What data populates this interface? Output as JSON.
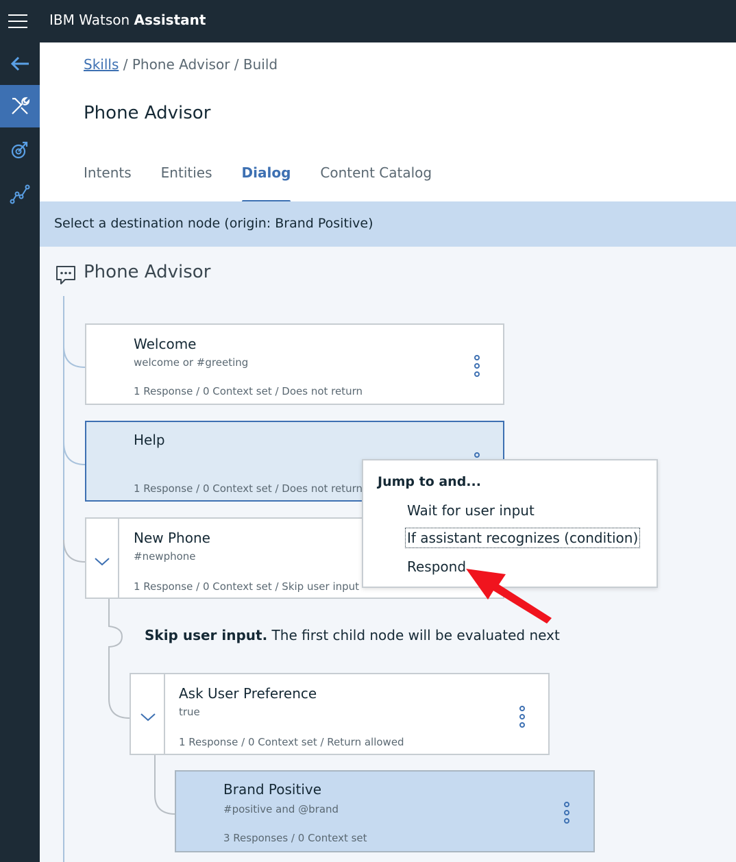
{
  "app": {
    "title_prefix": "IBM Watson",
    "title_bold": "Assistant"
  },
  "rail": {
    "items": [
      {
        "icon": "back-arrow-icon",
        "active": false
      },
      {
        "icon": "tools-icon",
        "active": true
      },
      {
        "icon": "improve-icon",
        "active": false
      },
      {
        "icon": "analytics-icon",
        "active": false
      }
    ]
  },
  "breadcrumb": {
    "link": "Skills",
    "rest": "/ Phone Advisor / Build"
  },
  "page_title": "Phone Advisor",
  "tabs": [
    {
      "label": "Intents",
      "active": false
    },
    {
      "label": "Entities",
      "active": false
    },
    {
      "label": "Dialog",
      "active": true
    },
    {
      "label": "Content Catalog",
      "active": false
    }
  ],
  "banner": {
    "text": "Select a destination node (origin: Brand Positive)"
  },
  "dialog": {
    "title": "Phone Advisor",
    "nodes": [
      {
        "title": "Welcome",
        "condition": "welcome or #greeting",
        "meta": "1 Response / 0 Context set / Does not return"
      },
      {
        "title": "Help",
        "condition": "",
        "meta": "1 Response / 0 Context set / Does not return"
      },
      {
        "title": "New Phone",
        "condition": "#newphone",
        "meta": "1 Response / 0 Context set / Skip user input"
      },
      {
        "title": "Ask User Preference",
        "condition": "true",
        "meta": "1 Response / 0 Context set / Return allowed"
      },
      {
        "title": "Brand Positive",
        "condition": "#positive and @brand",
        "meta": "3 Responses / 0 Context set"
      }
    ],
    "skip_bold": "Skip user input.",
    "skip_rest": " The first child node will be evaluated next"
  },
  "popup": {
    "title": "Jump to and...",
    "items": [
      "Wait for user input",
      "If assistant recognizes (condition)",
      "Respond"
    ]
  },
  "colors": {
    "topbar": "#1d2b36",
    "accent": "#3d70b2",
    "banner": "#c6daf0",
    "annotation_arrow": "#f0141e"
  }
}
